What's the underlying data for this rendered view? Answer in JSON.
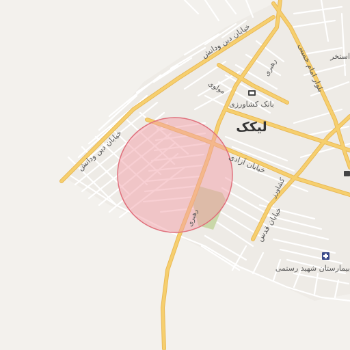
{
  "map": {
    "city_label": "لیکک",
    "street_labels": {
      "dinodanesh_top": "خیابان دین ودانش",
      "dinodanesh_left": "خیابان دین ودانش",
      "mowlavi": "مولوی",
      "rahbari_top": "رهبری",
      "rahbari_bottom": "رهبری",
      "azadi": "خیابان آزادی",
      "imam_khomeini": "بلوار امام خمینی",
      "keshavarz": "کشاورز",
      "qods": "خیابان قدس"
    },
    "poi_labels": {
      "bank": "بانک کشاورزی",
      "hospital": "بیمارستان شهید رستمی",
      "pool": "استخر"
    },
    "icons": [
      "bank-icon",
      "hospital-icon",
      "building-icon"
    ],
    "highlight": {
      "shape": "circle",
      "fill": "#f2a0a8",
      "stroke": "#e0707c"
    },
    "colors": {
      "background": "#f3f1ed",
      "road_major": "#f6cf6e",
      "road_minor": "#ffffff",
      "park": "#c9d7a8"
    }
  }
}
